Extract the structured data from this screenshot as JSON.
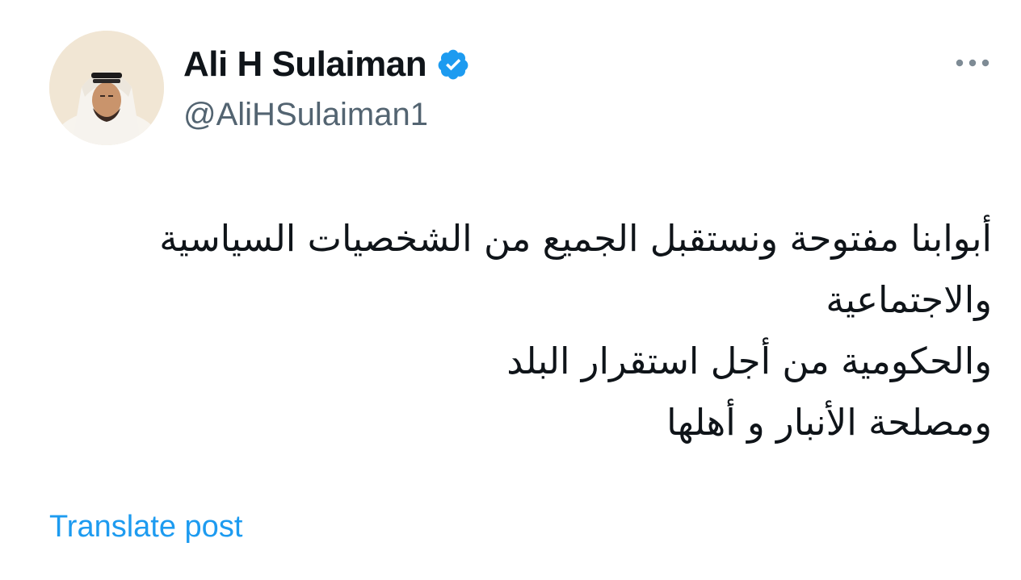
{
  "author": {
    "display_name": "Ali H Sulaiman",
    "handle": "@AliHSulaiman1",
    "verified": true,
    "avatar_icon": "profile-photo"
  },
  "icons": {
    "verified": "verified-badge-icon",
    "more": "more-options-icon"
  },
  "tweet": {
    "lines": [
      "أبوابنا مفتوحة ونستقبل الجميع من الشخصيات السياسية",
      "والاجتماعية",
      "والحكومية من أجل استقرار البلد",
      "ومصلحة الأنبار و أهلها"
    ]
  },
  "actions": {
    "translate_label": "Translate post"
  },
  "colors": {
    "accent": "#1d9bf0",
    "text_primary": "#0f1419",
    "text_secondary": "#536471"
  }
}
